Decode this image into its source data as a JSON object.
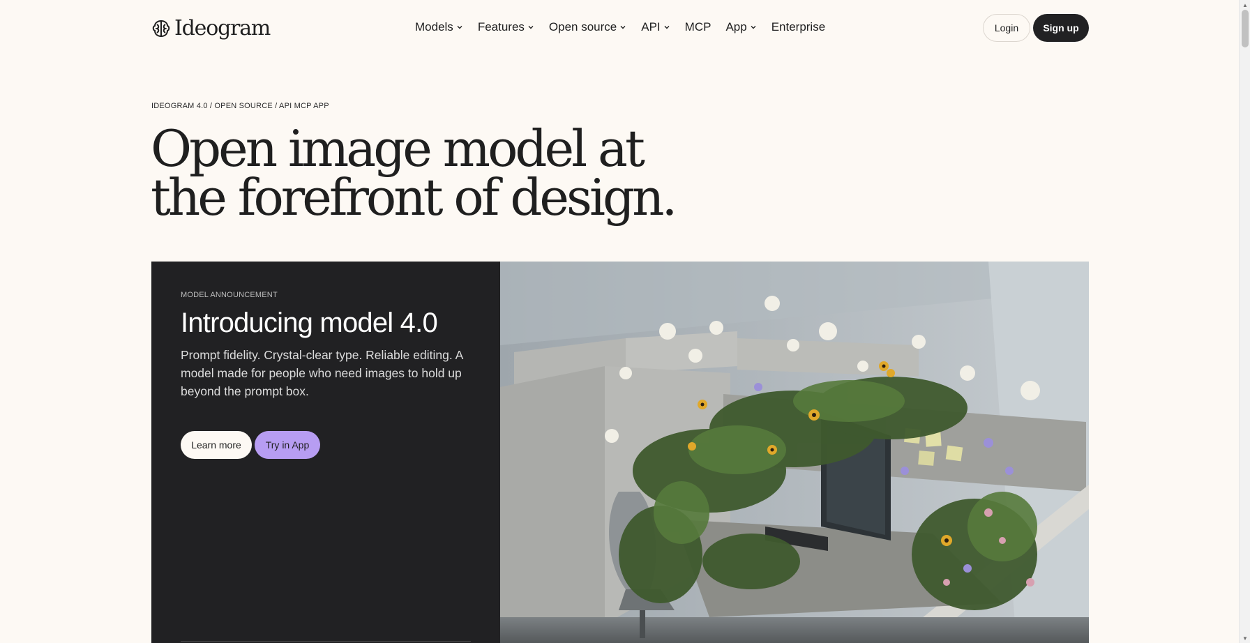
{
  "brand": {
    "name": "Ideogram"
  },
  "nav": {
    "items": [
      {
        "label": "Models",
        "has_dropdown": true
      },
      {
        "label": "Features",
        "has_dropdown": true
      },
      {
        "label": "Open source",
        "has_dropdown": true
      },
      {
        "label": "API",
        "has_dropdown": true
      },
      {
        "label": "MCP",
        "has_dropdown": false
      },
      {
        "label": "App",
        "has_dropdown": true
      },
      {
        "label": "Enterprise",
        "has_dropdown": false
      }
    ],
    "login_label": "Login",
    "signup_label": "Sign up"
  },
  "hero": {
    "breadcrumb": "IDEOGRAM 4.0 / OPEN SOURCE / API MCP APP",
    "title_line1": "Open image model at",
    "title_line2": "the forefront of design."
  },
  "feature_card": {
    "eyebrow": "MODEL ANNOUNCEMENT",
    "title": "Introducing model 4.0",
    "description": "Prompt fidelity. Crystal-clear type. Reliable editing. A model made for people who need images to hold up beyond the prompt box.",
    "learn_more_label": "Learn more",
    "try_label": "Try in App"
  },
  "colors": {
    "page_bg": "#fdf9f4",
    "dark": "#212123",
    "accent_purple": "#b79df2"
  },
  "icons": {
    "logo": "ideogram-logo-icon",
    "dropdown": "chevron-down-icon"
  }
}
